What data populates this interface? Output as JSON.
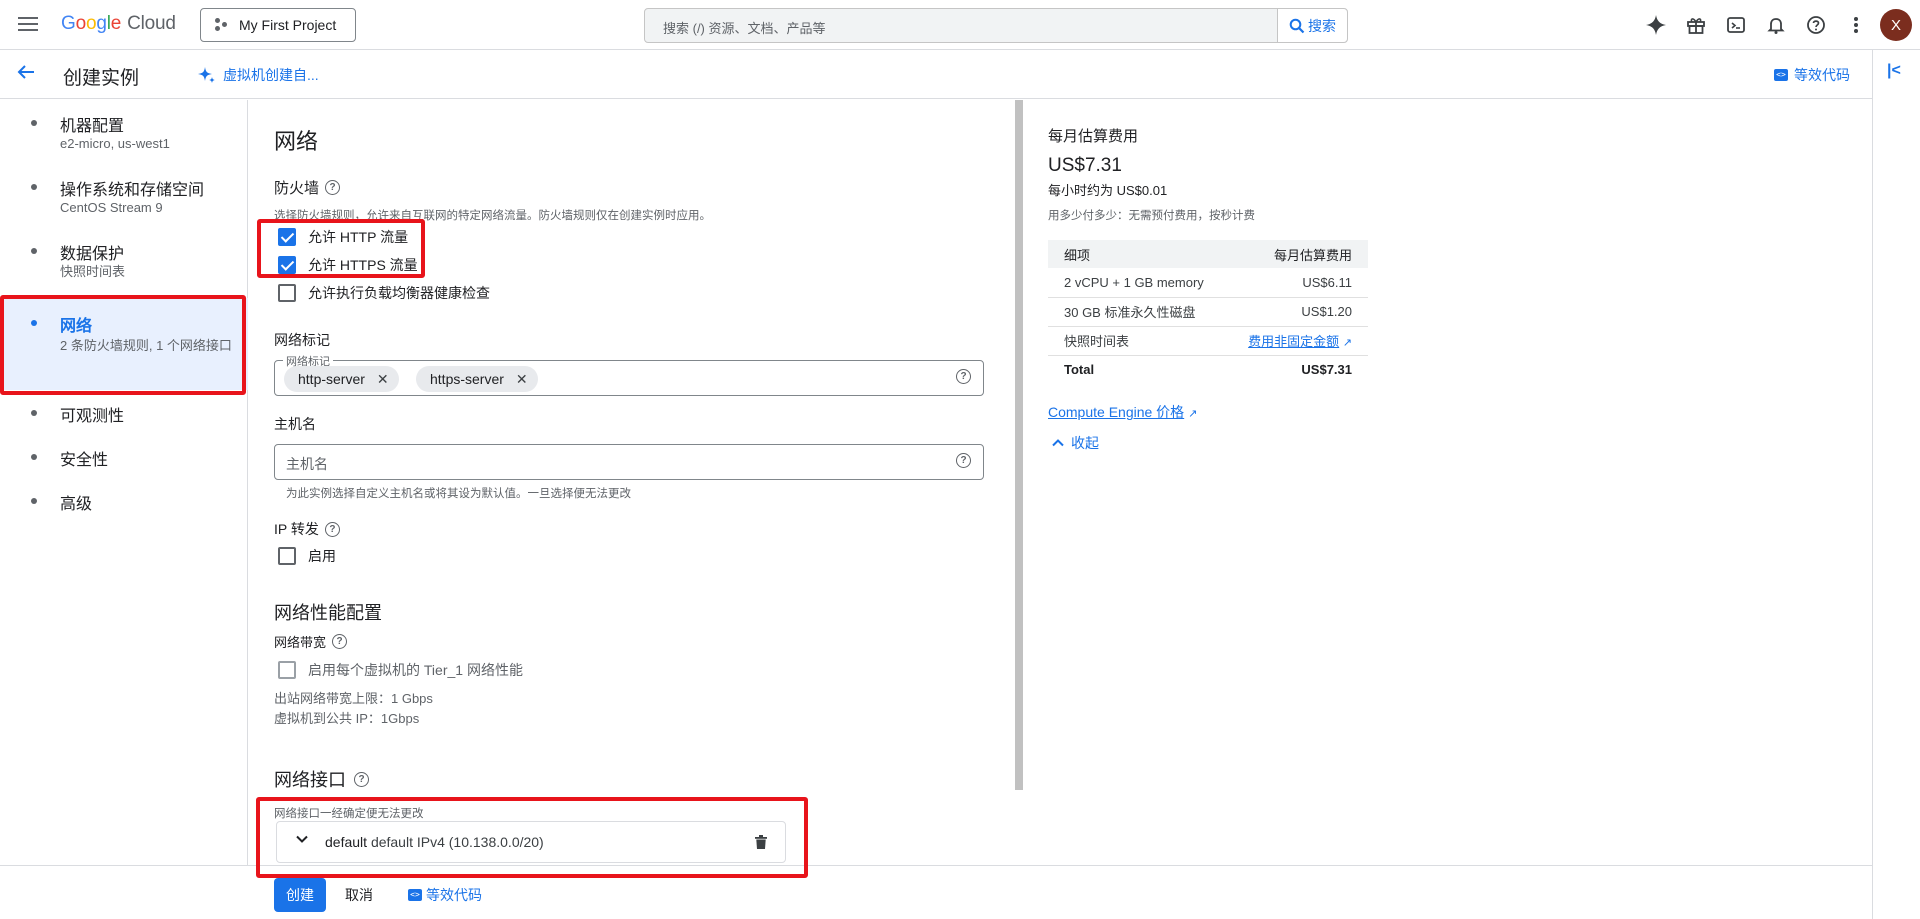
{
  "topbar": {
    "logo_google": [
      "G",
      "o",
      "o",
      "g",
      "l",
      "e"
    ],
    "logo_cloud": "Cloud",
    "project": "My First Project",
    "search_placeholder": "搜索 (/) 资源、文档、产品等",
    "search_button": "搜索",
    "avatar_initial": "X",
    "icons": [
      "gemini-icon",
      "gift-icon",
      "cloud-shell-icon",
      "bell-icon",
      "help-icon",
      "more-vert-icon"
    ]
  },
  "subheader": {
    "title": "创建实例",
    "ai_link": "虚拟机创建自...",
    "code_link": "等效代码"
  },
  "nav": [
    {
      "label": "机器配置",
      "sub": "e2-micro, us-west1"
    },
    {
      "label": "操作系统和存储空间",
      "sub": "CentOS Stream 9"
    },
    {
      "label": "数据保护",
      "sub": "快照时间表"
    },
    {
      "label": "网络",
      "sub": "2 条防火墙规则, 1 个网络接口"
    },
    {
      "label": "可观测性",
      "sub": ""
    },
    {
      "label": "安全性",
      "sub": ""
    },
    {
      "label": "高级",
      "sub": ""
    }
  ],
  "main": {
    "section_title": "网络",
    "firewall": {
      "title": "防火墙",
      "hint": "选择防火墙规则，允许来自互联网的特定网络流量。防火墙规则仅在创建实例时应用。",
      "options": [
        {
          "label": "允许 HTTP 流量",
          "checked": true
        },
        {
          "label": "允许 HTTPS 流量",
          "checked": true
        },
        {
          "label": "允许执行负载均衡器健康检查",
          "checked": false
        }
      ]
    },
    "tags": {
      "title": "网络标记",
      "field_label": "网络标记",
      "chips": [
        "http-server",
        "https-server"
      ]
    },
    "hostname": {
      "title": "主机名",
      "placeholder": "主机名",
      "hint": "为此实例选择自定义主机名或将其设为默认值。一旦选择便无法更改"
    },
    "ip_forward": {
      "title": "IP 转发",
      "option": "启用"
    },
    "perf": {
      "title": "网络性能配置",
      "bandwidth_title": "网络带宽",
      "option": "启用每个虚拟机的 Tier_1 网络性能",
      "egress": "出站网络带宽上限：1 Gbps",
      "public_ip": "虚拟机到公共 IP：1Gbps"
    },
    "interfaces": {
      "title": "网络接口",
      "hint": "网络接口一经确定便无法更改",
      "item_name": "default",
      "item_detail": "default IPv4 (10.138.0.0/20)"
    }
  },
  "cost": {
    "title": "每月估算费用",
    "amount": "US$7.31",
    "hourly": "每小时约为 US$0.01",
    "note": "用多少付多少：无需预付费用，按秒计费",
    "table_head": [
      "细项",
      "每月估算费用"
    ],
    "rows": [
      {
        "item": "2 vCPU + 1 GB memory",
        "price": "US$6.11"
      },
      {
        "item": "30 GB 标准永久性磁盘",
        "price": "US$1.20"
      },
      {
        "item": "快照时间表",
        "price": "费用非固定金额"
      },
      {
        "item": "Total",
        "price": "US$7.31"
      }
    ],
    "ce_link": "Compute Engine 价格",
    "collapse": "收起"
  },
  "footer": {
    "create": "创建",
    "cancel": "取消",
    "code": "等效代码"
  },
  "colors": {
    "accent": "#1a73e8",
    "highlight_box": "#e8141b",
    "avatar": "#7b2d1e"
  }
}
